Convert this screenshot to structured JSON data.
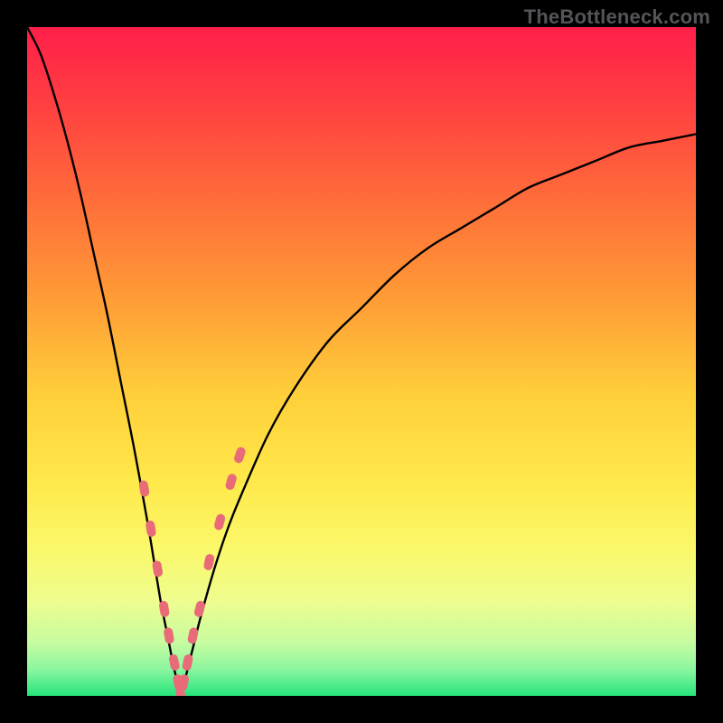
{
  "watermark": "TheBottleneck.com",
  "colors": {
    "frame": "#000000",
    "curve": "#000000",
    "marker_fill": "#e86b78",
    "marker_stroke": "#d85e6a",
    "gradient_stops": [
      {
        "offset": 0.0,
        "color": "#ff1f4a"
      },
      {
        "offset": 0.1,
        "color": "#ff3a42"
      },
      {
        "offset": 0.25,
        "color": "#ff6a3a"
      },
      {
        "offset": 0.4,
        "color": "#ff9a36"
      },
      {
        "offset": 0.55,
        "color": "#ffcf3a"
      },
      {
        "offset": 0.68,
        "color": "#ffe94a"
      },
      {
        "offset": 0.78,
        "color": "#fbf86a"
      },
      {
        "offset": 0.86,
        "color": "#edfd8f"
      },
      {
        "offset": 0.92,
        "color": "#c7fca0"
      },
      {
        "offset": 0.96,
        "color": "#8cf6a0"
      },
      {
        "offset": 1.0,
        "color": "#25e47b"
      }
    ]
  },
  "chart_data": {
    "type": "line",
    "title": "",
    "xlabel": "",
    "ylabel": "",
    "xlim": [
      0,
      100
    ],
    "ylim": [
      0,
      100
    ],
    "notes": "V-shaped bottleneck curve. y≈100·|x−23|/(x<23?23:77) roughly; minimum at x≈23 y≈0; left branch steep, right branch shallower and concave.",
    "x": [
      0,
      2,
      4,
      6,
      8,
      10,
      12,
      14,
      16,
      18,
      19,
      20,
      21,
      22,
      23,
      24,
      25,
      26,
      28,
      30,
      32,
      36,
      40,
      45,
      50,
      55,
      60,
      65,
      70,
      75,
      80,
      85,
      90,
      95,
      100
    ],
    "y": [
      100,
      96,
      90,
      83,
      75,
      66,
      57,
      47,
      37,
      26,
      20,
      14,
      9,
      4,
      0,
      4,
      8,
      12,
      19,
      25,
      30,
      39,
      46,
      53,
      58,
      63,
      67,
      70,
      73,
      76,
      78,
      80,
      82,
      83,
      84
    ],
    "series": [
      {
        "name": "markers",
        "note": "Pink rounded-dash markers clustered near the valley of the V",
        "points_x": [
          17.5,
          18.5,
          19.5,
          20.5,
          21.2,
          22.0,
          22.6,
          23.0,
          23.4,
          24.0,
          24.8,
          25.8,
          27.2,
          28.8,
          30.5,
          31.8
        ],
        "points_y": [
          31,
          25,
          19,
          13,
          9,
          5,
          2,
          0,
          2,
          5,
          9,
          13,
          20,
          26,
          32,
          36
        ]
      }
    ],
    "minimum": {
      "x": 23,
      "y": 0
    }
  }
}
